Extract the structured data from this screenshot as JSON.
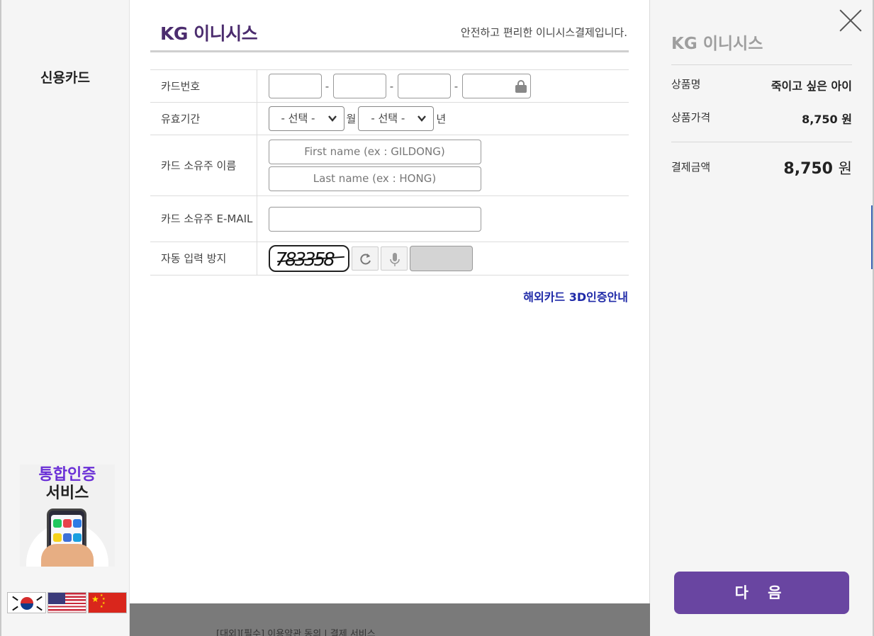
{
  "sidebar": {
    "payment_method": "신용카드",
    "promo_line1": "통합인증",
    "promo_line2": "서비스",
    "languages": [
      "ko",
      "en",
      "zh"
    ]
  },
  "header": {
    "logo": "KG 이니시스",
    "tagline": "안전하고 편리한 이니시스결제입니다."
  },
  "form": {
    "card_number_label": "카드번호",
    "card_dash": "-",
    "expiry_label": "유효기간",
    "expiry_month_value": "- 선택 -",
    "expiry_month_unit": "월",
    "expiry_year_value": "- 선택 -",
    "expiry_year_unit": "년",
    "owner_name_label": "카드 소유주 이름",
    "first_name_placeholder": "First name (ex : GILDONG)",
    "last_name_placeholder": "Last name (ex : HONG)",
    "owner_email_label": "카드 소유주 E-MAIL",
    "captcha_label": "자동 입력 방지",
    "captcha_text": "783358"
  },
  "links": {
    "overseas_3d": "해외카드 3D인증안내"
  },
  "bottom_bar": {
    "text": "[대외][필수] 이용약관 동의 | 결제 서비스"
  },
  "summary": {
    "logo": "KG 이니시스",
    "product_name_label": "상품명",
    "product_name": "죽이고 싶은 아이",
    "product_price_label": "상품가격",
    "product_price": "8,750",
    "currency": "원",
    "total_label": "결제금액",
    "total_amount": "8,750",
    "next_button": "다 음"
  },
  "colors": {
    "brand_purple": "#6945a1",
    "logo_purple": "#4b2c6e",
    "link_blue": "#1f2aa8",
    "promo_purple": "#6a2fd6"
  }
}
